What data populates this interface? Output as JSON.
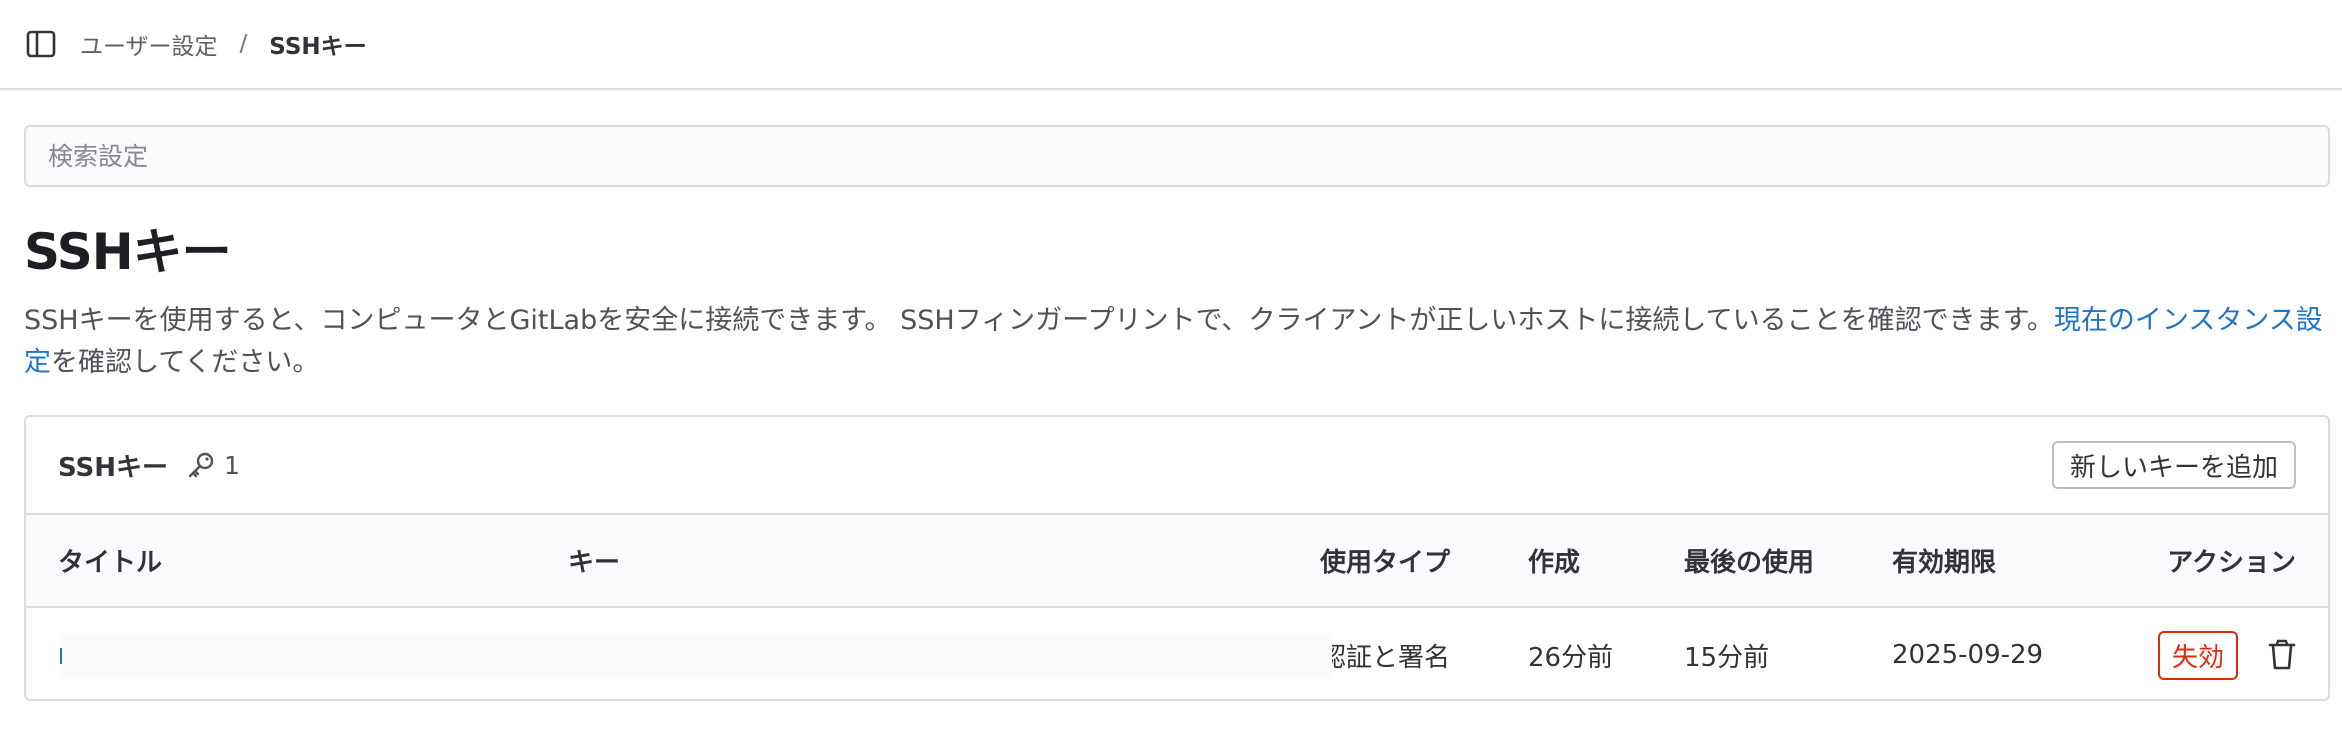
{
  "breadcrumb": {
    "parent": "ユーザー設定",
    "separator": "/",
    "current": "SSHキー"
  },
  "search": {
    "placeholder": "検索設定",
    "value": ""
  },
  "page": {
    "title": "SSHキー",
    "description_main": "SSHキーを使用すると、コンピュータとGitLabを安全に接続できます。 SSHフィンガープリントで、クライアントが正しいホストに接続していることを確認できます。",
    "description_link": "現在のインスタンス設定",
    "description_suffix": "を確認してください。"
  },
  "keys_card": {
    "title": "SSHキー",
    "count_icon": "key-icon",
    "count": "1",
    "add_button": "新しいキーを追加"
  },
  "table": {
    "headers": [
      "タイトル",
      "キー",
      "使用タイプ",
      "作成",
      "最後の使用",
      "有効期限",
      "アクション"
    ],
    "rows": [
      {
        "title": "",
        "key": "",
        "usage_type": "認証と署名",
        "created": "26分前",
        "last_used": "15分前",
        "expires": "2025-09-29",
        "action_revoke": "失効",
        "action_delete_icon": "trash-icon"
      }
    ]
  },
  "colors": {
    "link": "#1f75cb",
    "danger": "#dd2b0e",
    "border": "#dcdcde"
  }
}
